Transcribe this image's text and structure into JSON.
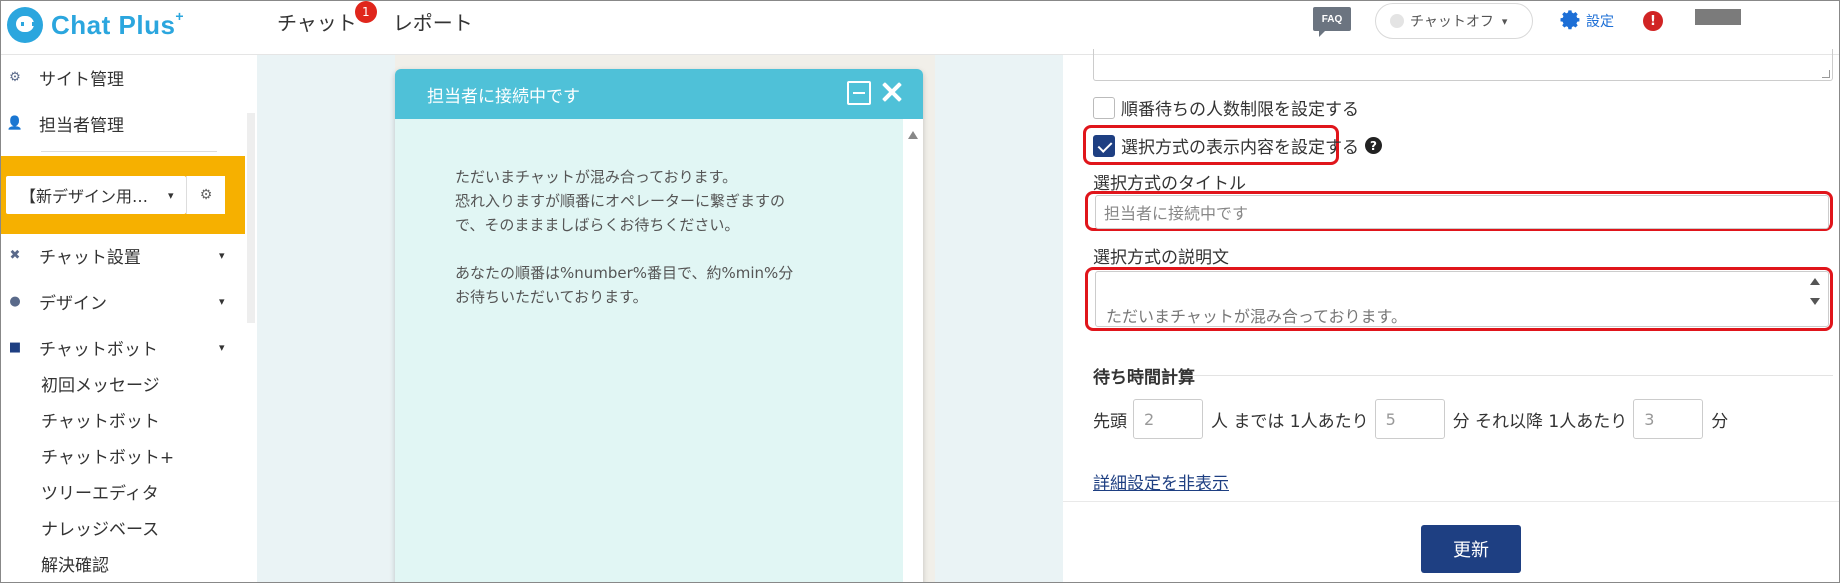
{
  "brand": {
    "name": "Chat Plus",
    "sup": "+"
  },
  "topnav": {
    "chat_label": "チャット",
    "chat_badge": "1",
    "report_label": "レポート"
  },
  "header": {
    "faq_label": "FAQ",
    "status_label": "チャットオフ",
    "settings_label": "設定",
    "alert_label": "!"
  },
  "sidebar": {
    "site_manage": "サイト管理",
    "agent_manage": "担当者管理",
    "site_select": "【新デザイン用…",
    "sections": [
      {
        "label": "チャット設置"
      },
      {
        "label": "デザイン"
      },
      {
        "label": "チャットボット"
      }
    ],
    "sub_items": [
      "初回メッセージ",
      "チャットボット",
      "チャットボット+",
      "ツリーエディタ",
      "ナレッジベース",
      "解決確認"
    ]
  },
  "preview": {
    "title": "担当者に接続中です",
    "message1": "ただいまチャットが混み合っております。\n恐れ入りますが順番にオペレーターに繋ぎますの\nで、そのままましばらくお待ちください。",
    "message2": "あなたの順番は%number%番目で、約%min%分\nお待ちいただいております。"
  },
  "panel": {
    "checkbox_queue_limit": "順番待ちの人数制限を設定する",
    "checkbox_selection_display": "選択方式の表示内容を設定する",
    "title_label": "選択方式のタイトル",
    "title_value": "担当者に接続中です",
    "desc_label": "選択方式の説明文",
    "desc_value": "ただいまチャットが混み合っております。\n恐れ入りますが順番にオペレーターに繋ぎますので、そのままましばらくお待ちください。",
    "wait_title": "待ち時間計算",
    "wait": {
      "prefix": "先頭",
      "first_count": "2",
      "mid1": "人 までは 1人あたり",
      "first_minutes": "5",
      "mid2": "分 それ以降 1人あたり",
      "after_minutes": "3",
      "suffix": "分"
    },
    "toggle_detail": "詳細設定を非表示",
    "update_button": "更新"
  },
  "colors": {
    "accent": "#2ba6de",
    "primary": "#1e3f82",
    "highlight": "#e0151b",
    "site_box": "#f6b000",
    "chat_header": "#4fc1d8"
  }
}
